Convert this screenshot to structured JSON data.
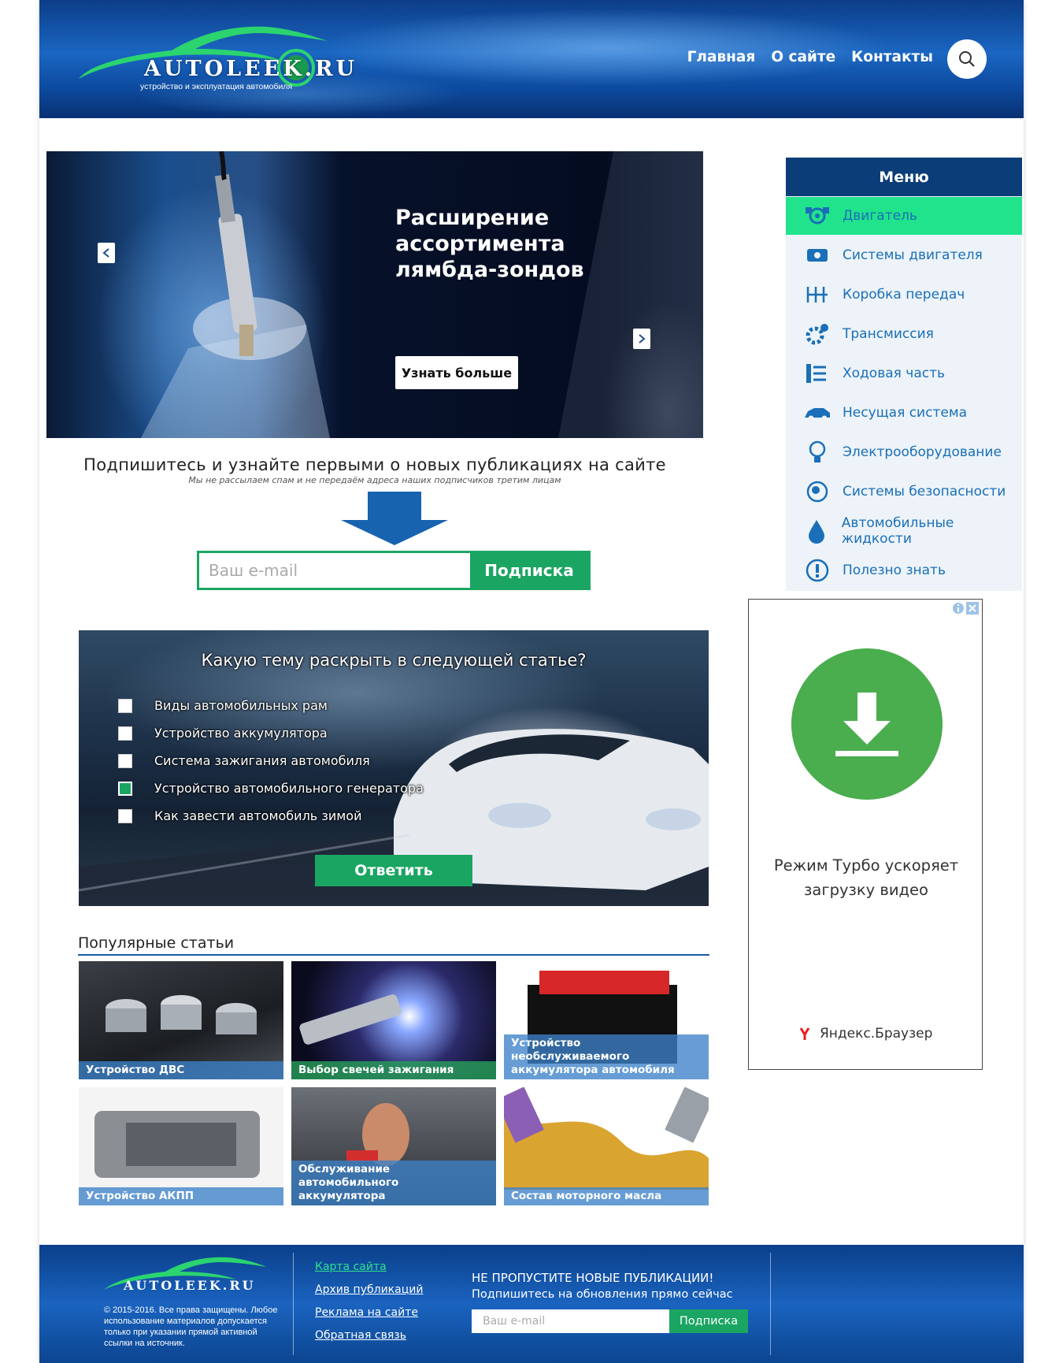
{
  "header": {
    "logo_text": "AUTOLEEK.RU",
    "logo_subtitle": "устройство и эксплуатация автомобиля",
    "nav": [
      "Главная",
      "О сайте",
      "Контакты"
    ]
  },
  "slider": {
    "title_lines": [
      "Расширение",
      "ассортимента",
      "лямбда-зондов"
    ],
    "button_label": "Узнать больше"
  },
  "subscribe": {
    "title": "Подпишитесь и узнайте первыми о новых публикациях на сайте",
    "note": "Мы не рассылаем спам и не передаём адреса наших подписчиков третим лицам",
    "placeholder": "Ваш e-mail",
    "button_label": "Подписка"
  },
  "poll": {
    "question": "Какую тему раскрыть в следующей статье?",
    "options": [
      {
        "label": "Виды автомобильных рам",
        "checked": false
      },
      {
        "label": "Устройство аккумулятора",
        "checked": false
      },
      {
        "label": "Система зажигания автомобиля",
        "checked": false
      },
      {
        "label": "Устройство автомобильного генератора",
        "checked": true
      },
      {
        "label": "Как завести автомобиль зимой",
        "checked": false
      }
    ],
    "button_label": "Ответить"
  },
  "popular": {
    "title": "Популярные статьи",
    "articles": [
      "Устройство ДВС",
      "Выбор свечей зажигания",
      "Устройство необслуживаемого аккумулятора автомобиля",
      "Устройство АКПП",
      "Обслуживание автомобильного аккумулятора",
      "Состав моторного масла"
    ]
  },
  "menu": {
    "title": "Меню",
    "items": [
      {
        "label": "Двигатель",
        "icon": "engine-icon"
      },
      {
        "label": "Системы двигателя",
        "icon": "engine-block-icon"
      },
      {
        "label": "Коробка передач",
        "icon": "gearbox-icon"
      },
      {
        "label": "Трансмиссия",
        "icon": "gears-icon"
      },
      {
        "label": "Ходовая часть",
        "icon": "suspension-icon"
      },
      {
        "label": "Несущая система",
        "icon": "car-body-icon"
      },
      {
        "label": "Электрооборудование",
        "icon": "lightbulb-icon"
      },
      {
        "label": "Системы безопасности",
        "icon": "airbag-icon"
      },
      {
        "label": "Автомобильные жидкости",
        "icon": "drop-icon"
      },
      {
        "label": "Полезно знать",
        "icon": "exclamation-icon"
      }
    ]
  },
  "ad": {
    "text": "Режим Турбо ускоряет загрузку видео",
    "brand": "Яндекс.Браузер"
  },
  "footer": {
    "logo_text": "AUTOLEEK.RU",
    "copyright": "© 2015-2016. Все права защищены. Любое использование материалов допускается только при указании прямой активной ссылки на источник.",
    "links": [
      "Карта сайта",
      "Архив публикаций",
      "Реклама на сайте",
      "Обратная связь"
    ],
    "sub_title": "НЕ ПРОПУСТИТЕ НОВЫЕ ПУБЛИКАЦИИ!",
    "sub_text": "Подпишитесь на обновления прямо сейчас",
    "placeholder": "Ваш e-mail",
    "button_label": "Подписка"
  },
  "colors": {
    "brand_blue": "#0b3d78",
    "accent_green": "#1ba562",
    "menu_active": "#20e38b",
    "link_blue": "#1a6fb8"
  }
}
